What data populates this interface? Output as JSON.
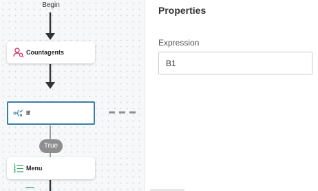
{
  "flow": {
    "start_label": "Begin",
    "nodes": [
      {
        "label": "Countagents",
        "icon": "user-search-icon"
      },
      {
        "label": "If",
        "icon": "condition-icon"
      },
      {
        "label": "Menu",
        "icon": "numbered-list-icon"
      }
    ],
    "branch_label": "True"
  },
  "properties": {
    "title": "Properties",
    "expression_label": "Expression",
    "expression_value": "B1"
  },
  "colors": {
    "selected_border": "#3a7fa6",
    "user_icon": "#d63a6f",
    "list_icon_accent": "#2e9b5f",
    "connector": "#333333",
    "branch_badge": "#8e8e8e"
  }
}
